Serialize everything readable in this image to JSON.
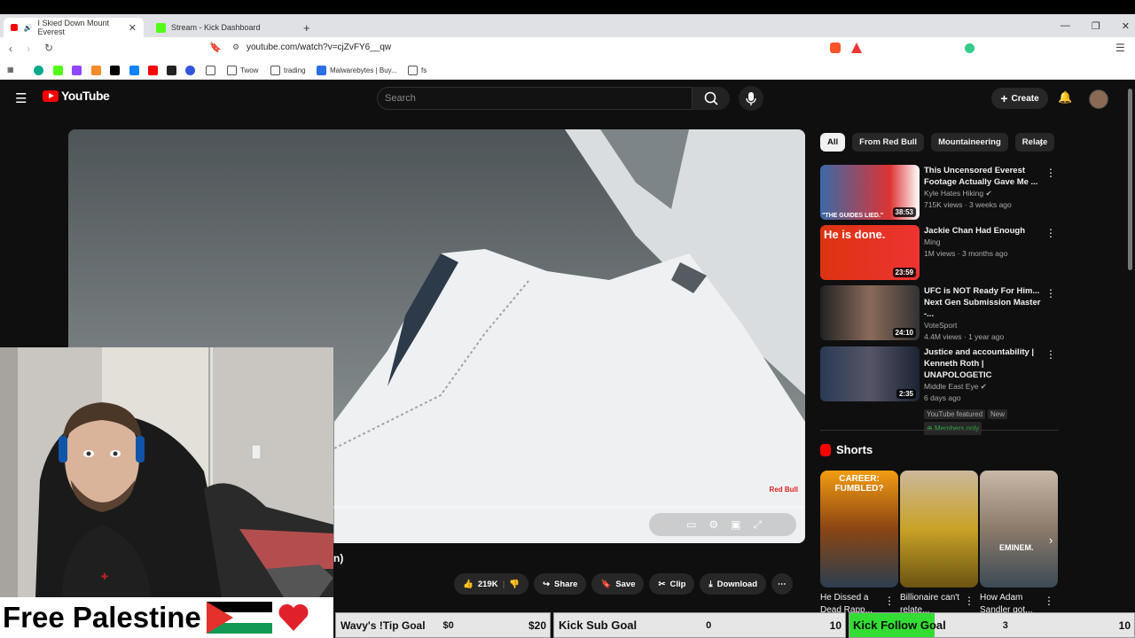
{
  "browser": {
    "tabs": [
      {
        "label": "I Skied Down Mount Everest",
        "active": true
      },
      {
        "label": "Stream - Kick Dashboard",
        "active": false
      }
    ],
    "url": "youtube.com/watch?v=cjZvFY6__qw",
    "bookmarks": [
      "Twow",
      "trading",
      "Malwarebytes | Buy...",
      "fs"
    ]
  },
  "youtube": {
    "logo": "YouTube",
    "search_placeholder": "Search",
    "create_label": "Create",
    "chips": [
      "All",
      "From Red Bull",
      "Mountaineering",
      "Relate"
    ],
    "player": {
      "watermark": "Red Bull",
      "title_fragment": "n)"
    },
    "actions": {
      "likes": "219K",
      "share": "Share",
      "save": "Save",
      "clip": "Clip",
      "download": "Download"
    },
    "recommendations": [
      {
        "title": "This Uncensored Everest Footage Actually Gave Me ...",
        "channel": "Kyle Hates Hiking",
        "verified": true,
        "meta": "715K views · 3 weeks ago",
        "duration": "38:53",
        "thumb_text": "\"THE GUIDES LIED.\""
      },
      {
        "title": "Jackie Chan Had Enough",
        "channel": "Ming",
        "verified": false,
        "meta": "1M views · 3 months ago",
        "duration": "23:59",
        "thumb_text": "He is done."
      },
      {
        "title": "UFC is NOT Ready For Him... Next Gen Submission Master -...",
        "channel": "VoteSport",
        "verified": false,
        "meta": "4.4M views · 1 year ago",
        "duration": "24:10",
        "thumb_text": ""
      },
      {
        "title": "Justice and accountability | Kenneth Roth | UNAPOLOGETIC",
        "channel": "Middle East Eye",
        "verified": true,
        "meta": "6 days ago",
        "duration": "2:35",
        "thumb_text": "",
        "tags": [
          "YouTube featured",
          "New"
        ],
        "members": "Members only"
      }
    ],
    "shorts_heading": "Shorts",
    "shorts": [
      {
        "title": "He Dissed a Dead Rapp...",
        "thumb_text": "CAREER: FUMBLED?"
      },
      {
        "title": "Billionaire can't relate...",
        "thumb_text": ""
      },
      {
        "title": "How Adam Sandler got...",
        "thumb_text": "EMINEM."
      }
    ]
  },
  "overlay": {
    "banner": "Free Palestine",
    "goals": [
      {
        "label": "Wavy's !Tip Goal",
        "current": "$0",
        "target": "$20"
      },
      {
        "label": "Kick Sub Goal",
        "current": "0",
        "target": "10"
      },
      {
        "label": "Kick Follow Goal",
        "current": "3",
        "target": "10",
        "progress": 0.3
      }
    ]
  },
  "colors": {
    "yt_red": "#ff0000",
    "goal_fill": "#33dd33",
    "bg": "#0f0f0f"
  }
}
